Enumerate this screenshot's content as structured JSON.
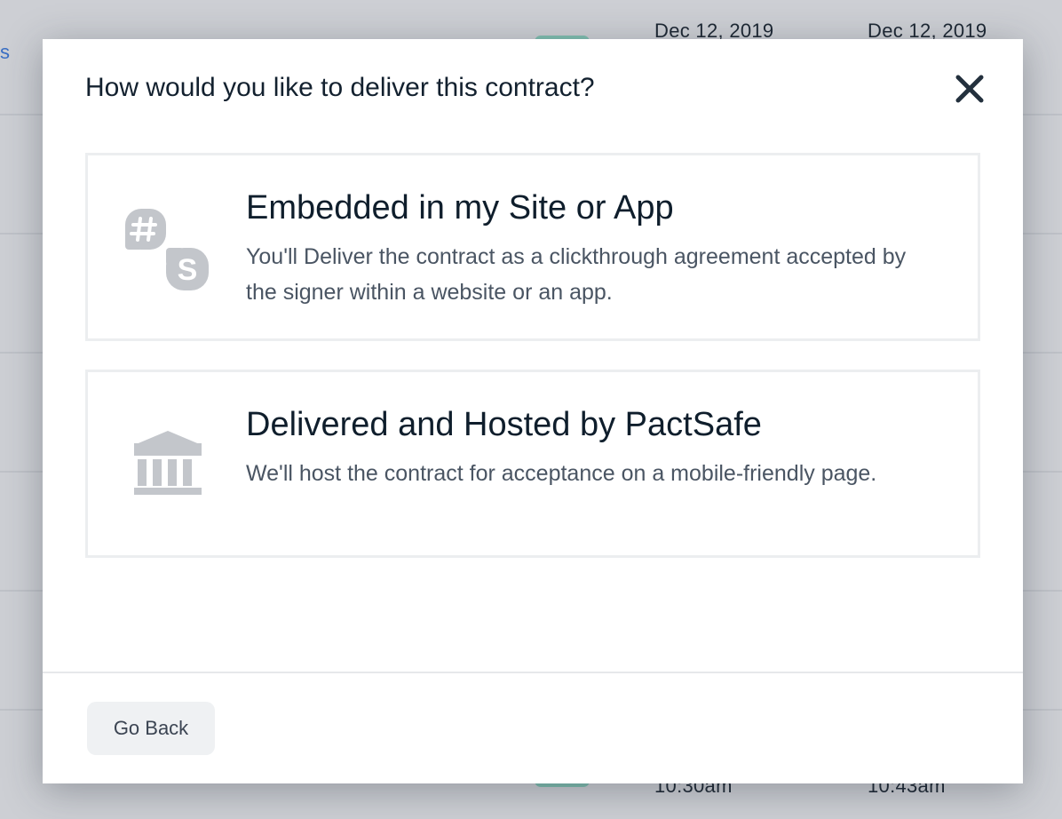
{
  "background": {
    "link_fragment": "s",
    "dates_top": [
      "Dec 12, 2019",
      "Dec 12, 2019"
    ],
    "times_bottom": [
      "10:30am",
      "10:43am"
    ]
  },
  "modal": {
    "title": "How would you like to deliver this contract?",
    "close_icon": "close-icon",
    "options": [
      {
        "icon": "slack-skype-icon",
        "title": "Embedded in my Site or App",
        "description": "You'll Deliver the contract as a clickthrough agreement accepted by the signer within a website or an app."
      },
      {
        "icon": "bank-building-icon",
        "title": "Delivered and Hosted by PactSafe",
        "description": "We'll host the contract for acceptance on a mobile-friendly page."
      }
    ],
    "go_back_label": "Go Back"
  },
  "colors": {
    "overlay": "#cdcfd4",
    "title_text": "#13212f",
    "body_text": "#4a5563",
    "icon_gray": "#c3c6cb",
    "card_border": "#eceef0",
    "button_bg": "#eff1f3",
    "link_blue": "#3a6fc4",
    "status_pill": "#7fbfb0"
  }
}
